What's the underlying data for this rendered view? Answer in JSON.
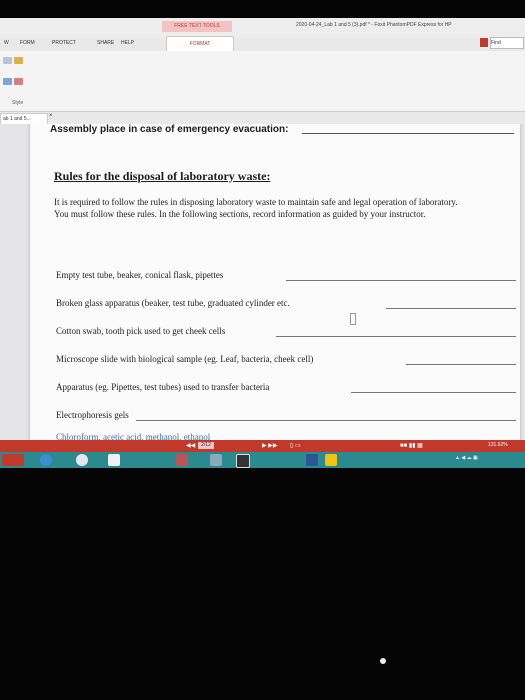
{
  "titlebar": {
    "context_tab": "FREE TEXT TOOLS",
    "window_title": "2020-04-24_Lab 1 and 5 (3).pdf * - Foxit PhantomPDF Express for HP"
  },
  "ribbon": {
    "tabs": [
      "W",
      "FORM",
      "PROTECT",
      "SHARE",
      "HELP"
    ],
    "active_tab": "FORMAT",
    "find_label": "Find",
    "style_label": "Style"
  },
  "doc_tab": {
    "label": "ab 1 and 5...",
    "close": "×"
  },
  "document": {
    "previous_line": "Assembly place in case of emergency evacuation:",
    "heading": "Rules for the disposal of laboratory waste:",
    "intro": "It is required to follow the rules in disposing laboratory waste to maintain safe and legal operation of laboratory. You must follow these rules. In the following sections, record information as guided by your instructor.",
    "rows": [
      "Empty test tube, beaker, conical flask, pipettes",
      "Broken glass apparatus (beaker, test tube, graduated cylinder etc.",
      "Cotton swab, tooth pick used to get cheek cells",
      "Microscope slide with biological sample (eg. Leaf, bacteria, cheek cell)",
      "Apparatus (eg. Pipettes, test tubes) used to transfer bacteria",
      "Electrophoresis gels",
      "Chloroform, acetic acid, methanol, ethanol"
    ]
  },
  "status_bar": {
    "page": "2/12",
    "zoom": "131.62%"
  },
  "colors": {
    "accent": "#c0392b",
    "taskbar": "#2a8a8f"
  }
}
